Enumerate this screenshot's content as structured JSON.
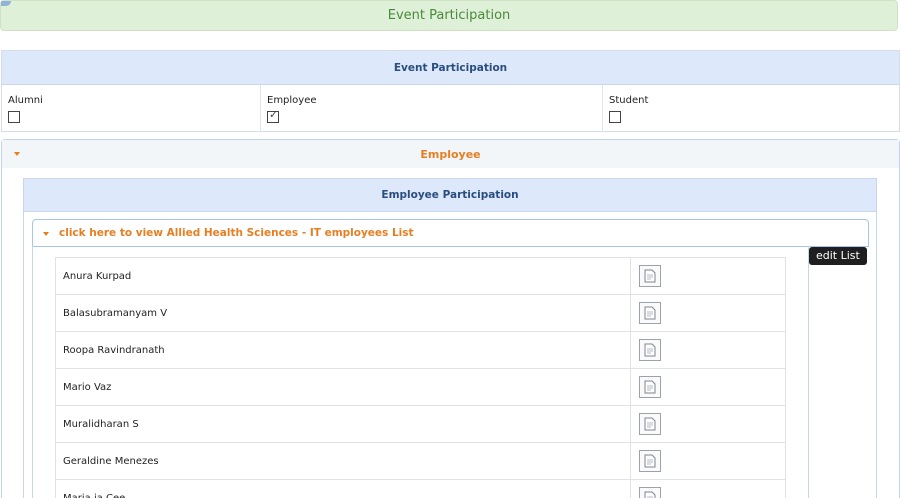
{
  "banner": {
    "title": "Event Participation"
  },
  "event_panel": {
    "header": "Event Participation",
    "options": [
      {
        "label": "Alumni",
        "checked": false
      },
      {
        "label": "Employee",
        "checked": true
      },
      {
        "label": "Student",
        "checked": false
      }
    ]
  },
  "employee_section": {
    "header": "Employee",
    "participation_header": "Employee Participation",
    "department_link": "click here to view Allied Health Sciences - IT employees List",
    "edit_list_label": "edit List",
    "employees": [
      "Anura Kurpad",
      "Balasubramanyam V",
      "Roopa Ravindranath",
      "Mario Vaz",
      "Muralidharan S",
      "Geraldine Menezes",
      "Maria ja Cee"
    ]
  },
  "icons": {
    "row_action": "document-icon",
    "accordion": "caret-down-icon"
  },
  "colors": {
    "banner_bg": "#dff0d8",
    "banner_text": "#4a8a3a",
    "header_bg": "#dde9fb",
    "header_text": "#2a4d7f",
    "accent_orange": "#e67e22"
  }
}
